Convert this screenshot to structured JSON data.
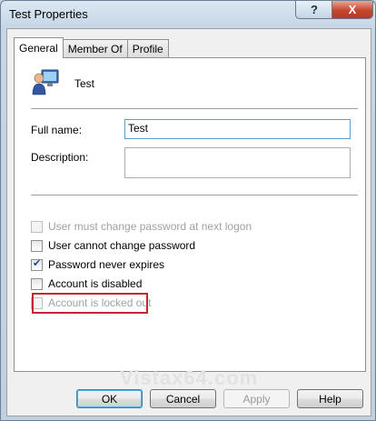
{
  "window": {
    "title": "Test Properties",
    "help_glyph": "?",
    "close_glyph": "X"
  },
  "tabs": [
    {
      "label": "General",
      "active": true
    },
    {
      "label": "Member Of",
      "active": false
    },
    {
      "label": "Profile",
      "active": false
    }
  ],
  "user": {
    "name": "Test",
    "icon": "user-computer-icon"
  },
  "fields": {
    "full_name_label": "Full name:",
    "full_name_value": "Test",
    "description_label": "Description:",
    "description_value": ""
  },
  "checkboxes": [
    {
      "label": "User must change password at next logon",
      "checked": false,
      "enabled": false
    },
    {
      "label": "User cannot change password",
      "checked": false,
      "enabled": true
    },
    {
      "label": "Password never expires",
      "checked": true,
      "enabled": true
    },
    {
      "label": "Account is disabled",
      "checked": false,
      "enabled": true
    },
    {
      "label": "Account is locked out",
      "checked": false,
      "enabled": false
    }
  ],
  "watermark": "Vistax64.com",
  "buttons": {
    "ok": "OK",
    "cancel": "Cancel",
    "apply": "Apply",
    "help": "Help"
  },
  "colors": {
    "highlight": "#c0282f",
    "title_close": "#c9452d"
  }
}
